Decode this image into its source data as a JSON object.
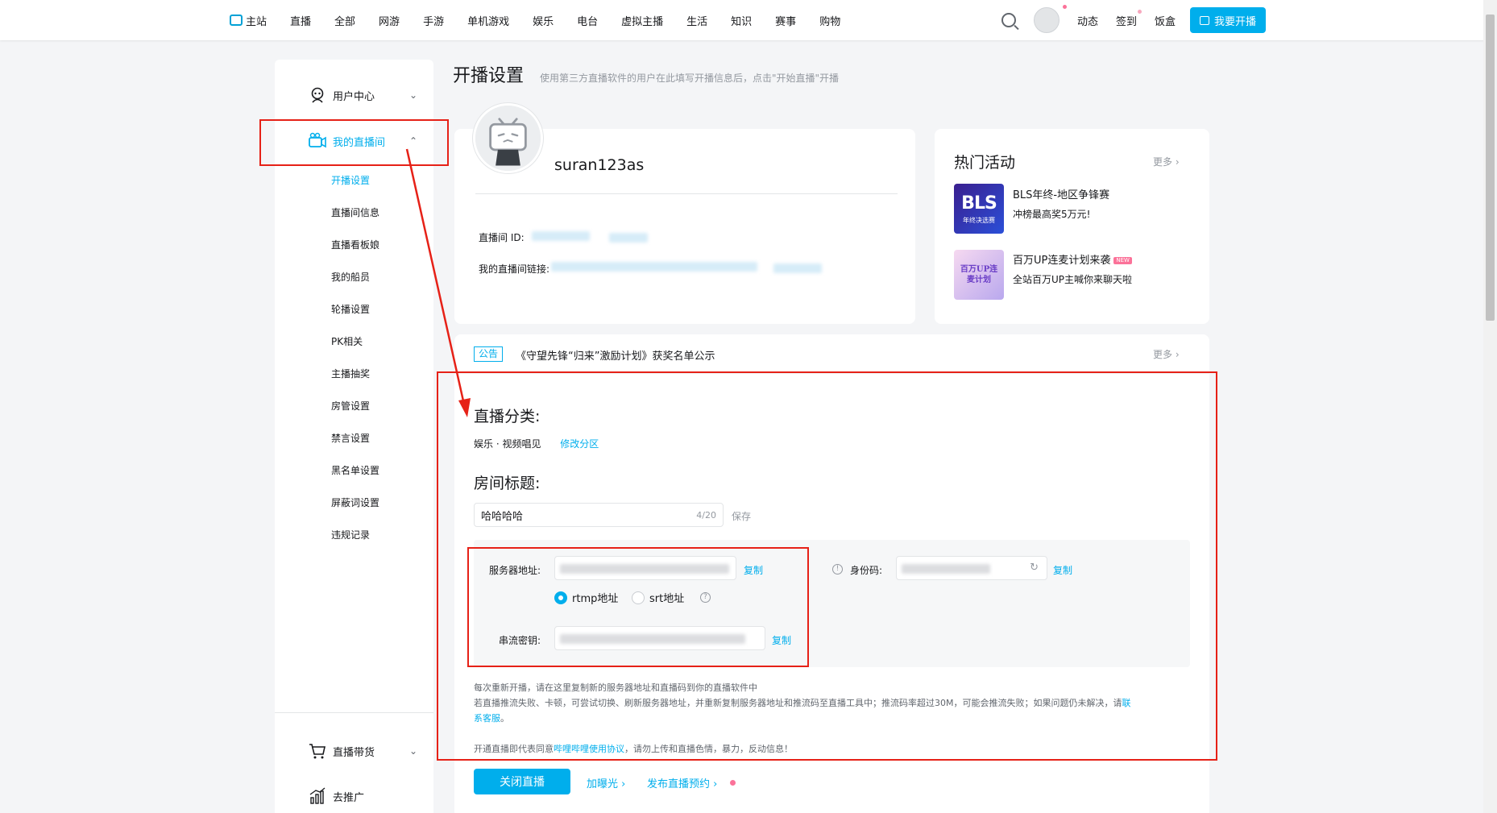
{
  "nav": {
    "items": [
      "主站",
      "直播",
      "全部",
      "网游",
      "手游",
      "单机游戏",
      "娱乐",
      "电台",
      "虚拟主播",
      "生活",
      "知识",
      "赛事",
      "购物"
    ],
    "right": {
      "dynamic": "动态",
      "checkin": "签到",
      "box": "饭盒",
      "start_live": "我要开播"
    }
  },
  "sidebar": {
    "user_center": "用户中心",
    "my_room": "我的直播间",
    "sub_items": [
      "开播设置",
      "直播间信息",
      "直播看板娘",
      "我的船员",
      "轮播设置",
      "PK相关",
      "主播抽奖",
      "房管设置",
      "禁言设置",
      "黑名单设置",
      "屏蔽词设置",
      "违规记录"
    ],
    "commerce": "直播带货",
    "promote": "去推广"
  },
  "page": {
    "title": "开播设置",
    "desc": "使用第三方直播软件的用户在此填写开播信息后，点击\"开始直播\"开播"
  },
  "profile": {
    "username": "suran123as",
    "room_id_label": "直播间 ID:",
    "room_link_label": "我的直播间链接:"
  },
  "hot": {
    "title": "热门活动",
    "more": "更多",
    "activities": [
      {
        "name": "BLS年终-地区争锋赛",
        "sub": "冲榜最高奖5万元!",
        "thumb_text": "BLS",
        "thumb_sub": "年终决选赛"
      },
      {
        "name": "百万UP连麦计划来袭",
        "sub": "全站百万UP主喊你来聊天啦",
        "badge": "NEW",
        "thumb_text": "百万UP连麦计划"
      }
    ]
  },
  "notice": {
    "tag": "公告",
    "text": "《守望先锋“归来”激励计划》获奖名单公示",
    "more": "更多"
  },
  "settings": {
    "category_title": "直播分类:",
    "category_value": "娱乐 · 视频唱见",
    "change_category": "修改分区",
    "room_title_label": "房间标题:",
    "room_title_value": "哈哈哈哈",
    "room_title_count": "4/20",
    "save": "保存",
    "server_label": "服务器地址:",
    "copy": "复制",
    "id_code_label": "身份码:",
    "rtmp": "rtmp地址",
    "srt": "srt地址",
    "stream_key_label": "串流密钥:",
    "hint1": "每次重新开播，请在这里复制新的服务器地址和直播码到你的直播软件中",
    "hint2_a": "若直播推流失败、卡顿，可尝试切换、刷新服务器地址，并重新复制服务器地址和推流码至直播工具中；推流码率超过30M，可能会推流失败；如果问题仍未解决，请",
    "hint2_link_a": "联",
    "hint2_link_b": "系客服",
    "hint2_end": "。",
    "agreement_prefix": "开通直播即代表同意",
    "agreement_link": "哔哩哔哩使用协议",
    "agreement_suffix": "，请勿上传和直播色情，暴力，反动信息！",
    "close_live": "关闭直播",
    "boost": "加曝光",
    "schedule": "发布直播预约"
  },
  "colors": {
    "accent": "#00aeec",
    "annotation": "#e62117",
    "pink": "#fb7299"
  }
}
